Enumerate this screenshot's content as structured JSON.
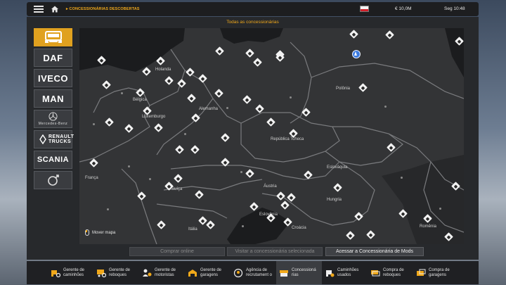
{
  "topbar": {
    "breadcrumb": "CONCESSIONÁRIAS DESCOBERTAS",
    "money": "€ 10,0M",
    "time": "Seg 10:48"
  },
  "panel": {
    "title": "Todas as concessionárias"
  },
  "brands": [
    {
      "id": "generic",
      "label": "",
      "active": true
    },
    {
      "id": "daf",
      "label": "DAF"
    },
    {
      "id": "iveco",
      "label": "IVECO"
    },
    {
      "id": "man",
      "label": "MAN"
    },
    {
      "id": "mercedes",
      "label": "Mercedes-Benz"
    },
    {
      "id": "renault",
      "label": "RENAULT TRUCKS"
    },
    {
      "id": "scania",
      "label": "SCANIA"
    },
    {
      "id": "volvo",
      "label": "VOLVO"
    }
  ],
  "map": {
    "countries": [
      "Holanda",
      "Bélgica",
      "Luxemburgo",
      "Alemanha",
      "Polônia",
      "República Tcheca",
      "Eslováquia",
      "França",
      "Suíça",
      "Áustria",
      "Hungria",
      "Eslovênia",
      "Itália",
      "Croácia",
      "Romênia"
    ],
    "move_hint": "Mover mapa"
  },
  "actions": {
    "buy_online": "Comprar online",
    "visit_selected": "Visitar a concessionária selecionada",
    "mods_dealer": "Acessar a Concessionária de Mods"
  },
  "bottom_tabs": [
    {
      "label": "Gerente de caminhões",
      "icon": "truck-gear-icon"
    },
    {
      "label": "Gerente de reboques",
      "icon": "trailer-gear-icon"
    },
    {
      "label": "Gerente de motoristas",
      "icon": "drivers-icon"
    },
    {
      "label": "Gerente de garagens",
      "icon": "garage-icon"
    },
    {
      "label": "Agência de recrutament o",
      "icon": "recruitment-icon"
    },
    {
      "label": "Concessioná rias",
      "icon": "dealer-icon",
      "active": true
    },
    {
      "label": "Caminhões usados",
      "icon": "used-truck-icon"
    },
    {
      "label": "Compra de reboques",
      "icon": "buy-trailer-icon"
    },
    {
      "label": "Compra de garagens",
      "icon": "buy-garage-icon"
    }
  ]
}
